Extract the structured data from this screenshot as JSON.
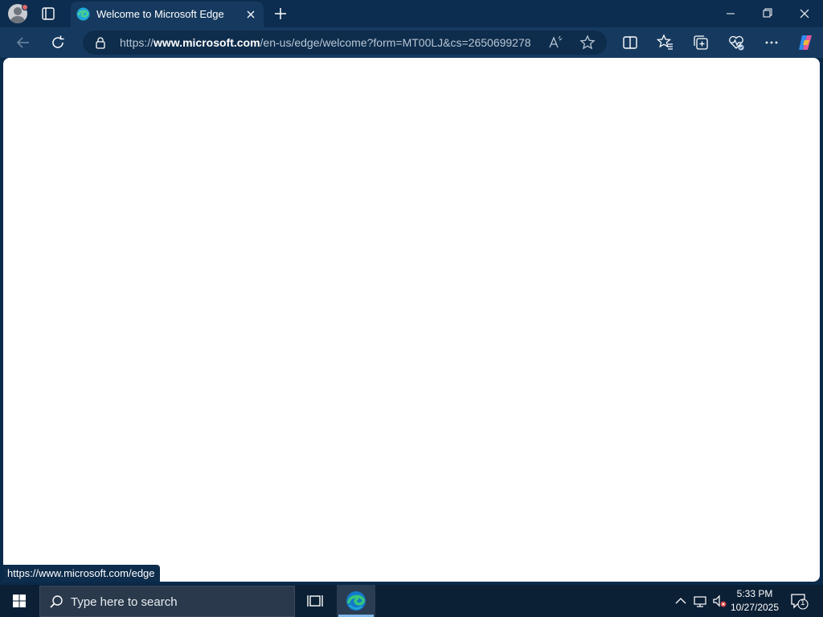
{
  "browser": {
    "tab": {
      "title": "Welcome to Microsoft Edge"
    },
    "address": {
      "prefix": "https://",
      "host": "www.microsoft.com",
      "path": "/en-us/edge/welcome?form=MT00LJ&cs=2650699278"
    },
    "status_link": "https://www.microsoft.com/edge"
  },
  "taskbar": {
    "search_placeholder": "Type here to search",
    "clock": {
      "time": "5:33 PM",
      "date": "10/27/2025"
    },
    "notification_count": "1"
  },
  "colors": {
    "title_bar": "#0c2d4f",
    "toolbar": "#163a5f",
    "page_background": "#ffffff",
    "taskbar": "#0b1f35",
    "accent": "#7fb7ea"
  },
  "icons": [
    "profile-avatar-icon",
    "tab-actions-icon",
    "edge-favicon-icon",
    "close-tab-icon",
    "new-tab-icon",
    "minimize-icon",
    "maximize-icon",
    "close-icon",
    "back-icon",
    "refresh-icon",
    "lock-icon",
    "read-aloud-icon",
    "favorite-star-icon",
    "split-screen-icon",
    "favorites-icon",
    "collections-icon",
    "browser-essentials-icon",
    "more-options-icon",
    "copilot-icon",
    "windows-start-icon",
    "search-icon",
    "task-view-icon",
    "edge-taskbar-icon",
    "chevron-up-icon",
    "network-icon",
    "volume-muted-icon",
    "notification-icon"
  ]
}
